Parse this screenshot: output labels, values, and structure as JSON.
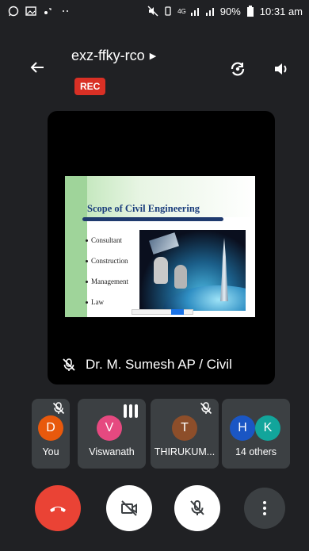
{
  "status_bar": {
    "battery": "90%",
    "time": "10:31 am",
    "network": "4G"
  },
  "header": {
    "meeting_code": "exz-ffky-rco",
    "rec_label": "REC"
  },
  "presentation": {
    "slide_title": "Scope of Civil Engineering",
    "slide_items": [
      "Consultant",
      "Construction",
      "Management",
      "Law"
    ],
    "presenter": "Dr. M. Sumesh AP / Civil"
  },
  "participants": [
    {
      "initial": "D",
      "name": "You",
      "color": "#e8590c",
      "mic": "muted"
    },
    {
      "initial": "V",
      "name": "Viswanath",
      "color": "#e64980",
      "mic": "speaking"
    },
    {
      "initial": "T",
      "name": "THIRUKUM...",
      "color": "#8d4e2a",
      "mic": "muted"
    },
    {
      "initials": [
        "H",
        "K"
      ],
      "name": "14 others",
      "colors": [
        "#1a56c4",
        "#12a59b"
      ],
      "mic": "none"
    }
  ],
  "controls": {
    "end_call_color": "#ea4335",
    "icons": [
      "end-call-icon",
      "camera-off-icon",
      "mic-off-icon",
      "more-vert-icon"
    ]
  }
}
